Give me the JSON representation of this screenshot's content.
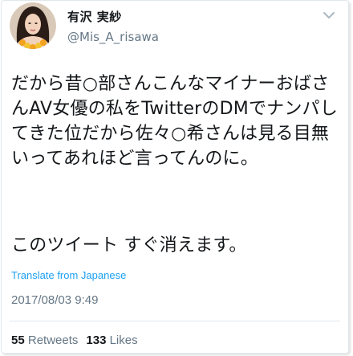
{
  "user": {
    "display_name": "有沢 実紗",
    "handle": "@Mis_A_risawa"
  },
  "tweet": {
    "text": "だから昔○部さんこんなマイナーおばさんAV女優の私をTwitterのDMでナンパしてきた位だから佐々○希さんは見る目無いってあれほど言ってんのに。",
    "text2": "このツイート すぐ消えます。",
    "translate_label": "Translate from Japanese",
    "timestamp": "2017/08/03 9:49"
  },
  "stats": {
    "retweets_count": "55",
    "retweets_label": "Retweets",
    "likes_count": "133",
    "likes_label": "Likes"
  },
  "colors": {
    "link": "#1da1f2",
    "secondary_text": "#657786",
    "primary_text": "#14171a"
  },
  "icons": {
    "menu": "chevron-down-icon"
  }
}
